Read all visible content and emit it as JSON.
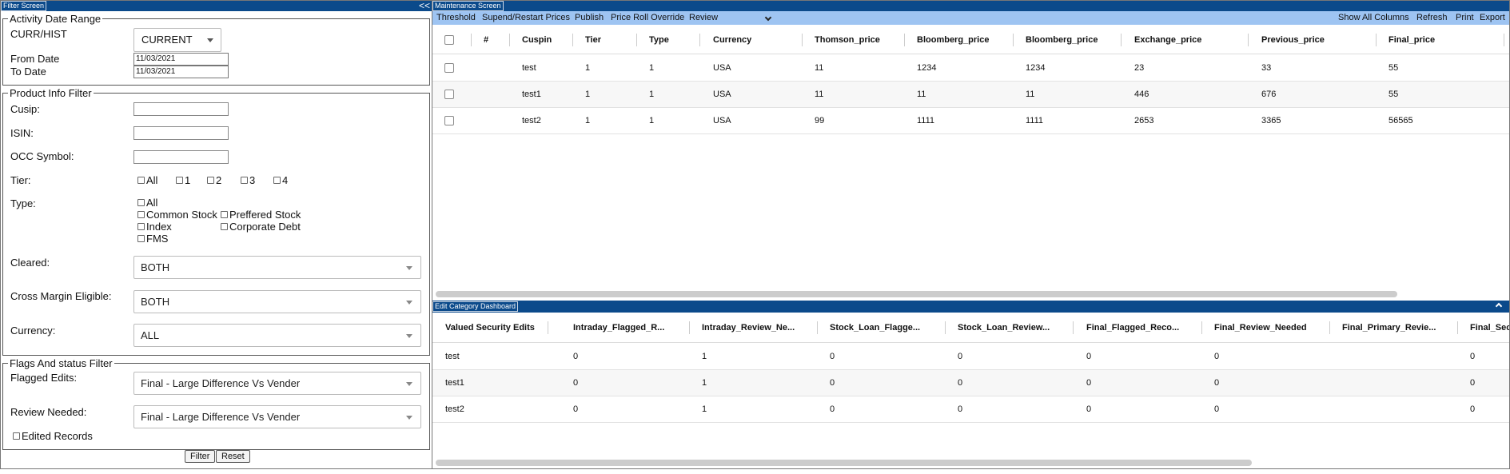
{
  "left": {
    "title": "Filter Screen",
    "collapse_label": "<<",
    "activity": {
      "legend": "Activity Date Range",
      "currhist_label": "CURR/HIST",
      "currhist_value": "CURRENT",
      "from_label": "From Date",
      "from_value": "11/03/2021",
      "to_label": "To Date",
      "to_value": "11/03/2021"
    },
    "product": {
      "legend": "Product Info Filter",
      "cusip_label": "Cusip:",
      "isin_label": "ISIN:",
      "occ_label": "OCC Symbol:",
      "tier_label": "Tier:",
      "tier_options": [
        "All",
        "1",
        "2",
        "3",
        "4"
      ],
      "type_label": "Type:",
      "type_options": [
        "All",
        "Common Stock",
        "Preffered Stock",
        "Index",
        "Corporate Debt",
        "FMS"
      ],
      "cleared_label": "Cleared:",
      "cleared_value": "BOTH",
      "cross_label": "Cross Margin Eligible:",
      "cross_value": "BOTH",
      "currency_label": "Currency:",
      "currency_value": "ALL"
    },
    "flags": {
      "legend": "Flags And status Filter",
      "flagged_label": "Flagged Edits:",
      "flagged_value": "Final - Large Difference Vs Vender",
      "review_label": "Review Needed:",
      "review_value": "Final - Large Difference Vs Vender",
      "edited_label": "Edited Records"
    },
    "filter_button": "Filter",
    "reset_button": "Reset"
  },
  "right": {
    "title": "Maintenance Screen",
    "menu": [
      "Threshold",
      "Supend/Restart Prices",
      "Publish",
      "Price Roll Override",
      "Review"
    ],
    "menu_right": [
      "Show All Columns",
      "Refresh",
      "Print",
      "Export"
    ],
    "grid": {
      "columns": [
        "#",
        "Cuspin",
        "Tier",
        "Type",
        "Currency",
        "Thomson_price",
        "Bloomberg_price",
        "Bloomberg_price",
        "Exchange_price",
        "Previous_price",
        "Final_price"
      ],
      "rows": [
        [
          "",
          "test",
          "1",
          "1",
          "USA",
          "11",
          "1234",
          "1234",
          "23",
          "33",
          "55"
        ],
        [
          "",
          "test1",
          "1",
          "1",
          "USA",
          "11",
          "11",
          "11",
          "446",
          "676",
          "55"
        ],
        [
          "",
          "test2",
          "1",
          "1",
          "USA",
          "99",
          "1111",
          "1111",
          "2653",
          "3365",
          "56565"
        ]
      ]
    },
    "dashboard": {
      "title": "Edit Category Dashboard",
      "columns": [
        "Valued Security Edits",
        "Intraday_Flagged_R...",
        "Intraday_Review_Ne...",
        "Stock_Loan_Flagge...",
        "Stock_Loan_Review...",
        "Final_Flagged_Reco...",
        "Final_Review_Needed",
        "Final_Primary_Revie...",
        "Final_Sec"
      ],
      "rows": [
        [
          "test",
          "0",
          "1",
          "0",
          "0",
          "0",
          "0",
          "",
          "0"
        ],
        [
          "test1",
          "0",
          "1",
          "0",
          "0",
          "0",
          "0",
          "",
          "0"
        ],
        [
          "test2",
          "0",
          "1",
          "0",
          "0",
          "0",
          "0",
          "",
          "0"
        ]
      ]
    }
  }
}
